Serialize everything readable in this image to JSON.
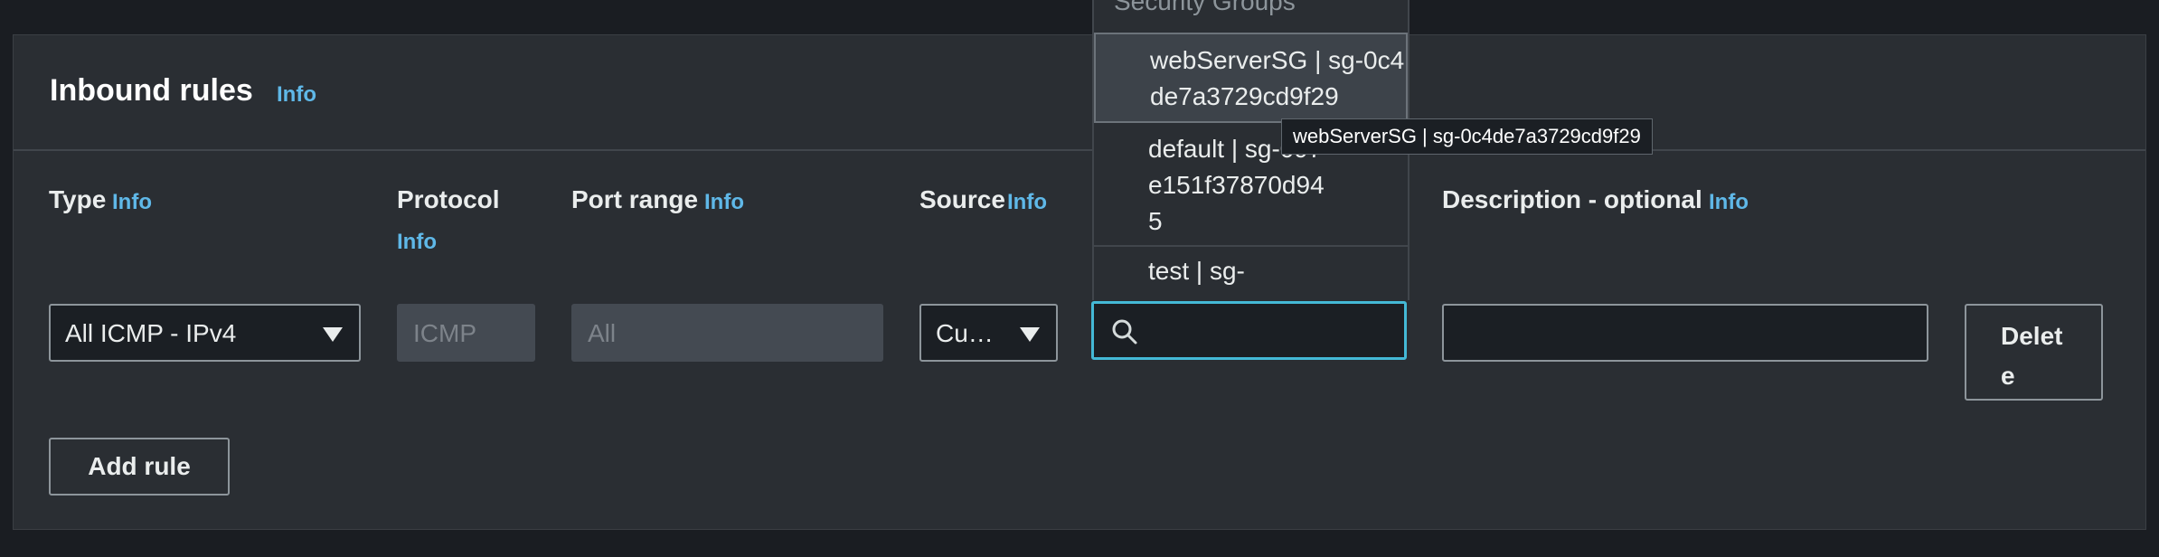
{
  "panel": {
    "title": "Inbound rules",
    "title_info": "Info"
  },
  "columns": {
    "type": {
      "label": "Type",
      "info": "Info"
    },
    "protocol": {
      "label": "Protocol",
      "info": "Info"
    },
    "port_range": {
      "label": "Port range",
      "info": "Info"
    },
    "source": {
      "label": "Source",
      "info": "Info"
    },
    "description": {
      "label": "Description - optional",
      "info": "Info"
    }
  },
  "rule": {
    "type_value": "All ICMP - IPv4",
    "protocol_value": "ICMP",
    "port_range_value": "All",
    "source_value": "Cu…",
    "search_value": "",
    "description_value": "",
    "delete_label": "Delete"
  },
  "add_rule_label": "Add rule",
  "dropdown": {
    "group_header": "Security Groups",
    "options": [
      {
        "label": "webServerSG | sg-0c4de7a3729cd9f29",
        "selected": true
      },
      {
        "label": "default | sg-097e151f37870d945",
        "selected": false
      },
      {
        "label": "test | sg-",
        "selected": false
      }
    ]
  },
  "tooltip": "webServerSG | sg-0c4de7a3729cd9f29",
  "colors": {
    "accent": "#44b9d6",
    "info_link": "#5fb8e8",
    "panel_bg": "#2a2e33",
    "page_bg": "#1a1d22"
  },
  "icons": {
    "search": "search-icon",
    "dropdown_caret": "caret-down-icon"
  }
}
